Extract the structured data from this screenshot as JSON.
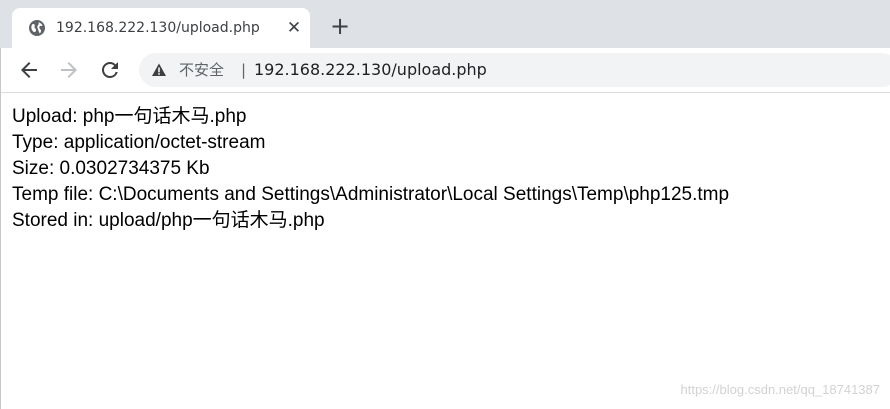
{
  "tab": {
    "title": "192.168.222.130/upload.php",
    "close_glyph": "✕",
    "favicon": "globe-icon"
  },
  "new_tab_glyph": "+",
  "toolbar": {
    "back_icon": "arrow-left-icon",
    "forward_icon": "arrow-right-icon",
    "reload_icon": "reload-icon"
  },
  "address_bar": {
    "security_label": "不安全",
    "separator": "|",
    "url": "192.168.222.130/upload.php",
    "warning_icon": "warning-triangle-icon"
  },
  "page": {
    "lines": [
      "Upload: php一句话木马.php",
      "Type: application/octet-stream",
      "Size: 0.0302734375 Kb",
      "Temp file: C:\\Documents and Settings\\Administrator\\Local Settings\\Temp\\php125.tmp",
      "Stored in: upload/php一句话木马.php"
    ]
  },
  "watermark": "https://blog.csdn.net/qq_18741387",
  "colors": {
    "tabstrip": "#dee1e6",
    "omnibox": "#f1f3f4",
    "text": "#000000"
  }
}
